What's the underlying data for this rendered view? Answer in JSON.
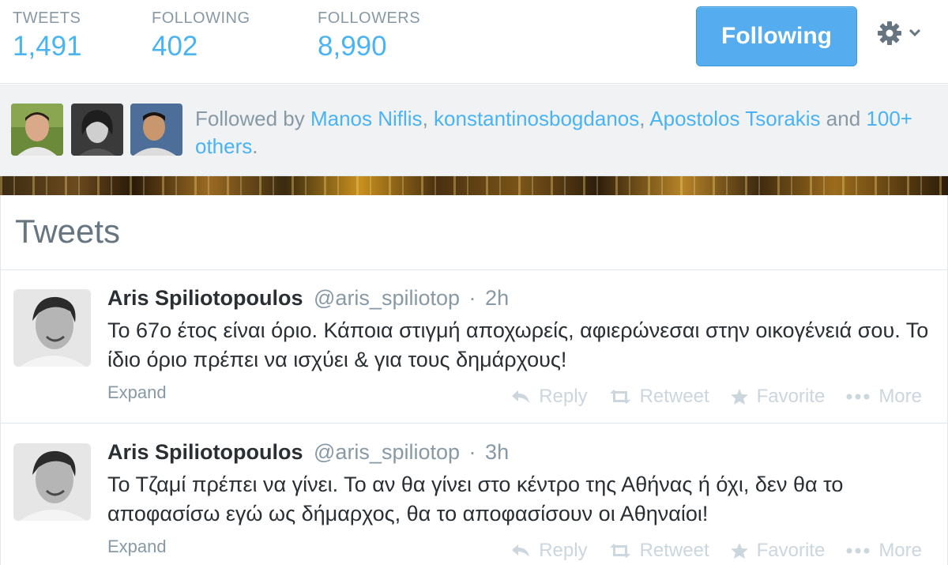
{
  "stats": {
    "tweets_label": "TWEETS",
    "tweets_value": "1,491",
    "following_label": "FOLLOWING",
    "following_value": "402",
    "followers_label": "FOLLOWERS",
    "followers_value": "8,990"
  },
  "follow_button": "Following",
  "followed_by": {
    "prefix": "Followed by",
    "users": [
      "Manos Niflis",
      "konstantinosbogdanos",
      "Apostolos Tsorakis"
    ],
    "sep": ",",
    "and": "and",
    "others": "100+ others",
    "end": "."
  },
  "timeline": {
    "title": "Tweets"
  },
  "tweets": [
    {
      "name": "Aris Spiliotopoulos",
      "handle": "@aris_spiliotop",
      "dot": "·",
      "time": "2h",
      "text": "Το 67ο έτος είναι όριο. Κάποια στιγμή αποχωρείς, αφιερώνεσαι στην οικογένειά σου. Το ίδιο όριο πρέπει να ισχύει & για τους δημάρχους!",
      "expand": "Expand"
    },
    {
      "name": "Aris Spiliotopoulos",
      "handle": "@aris_spiliotop",
      "dot": "·",
      "time": "3h",
      "text": "Το Τζαμί πρέπει να γίνει. Το αν θα γίνει στο κέντρο της Αθήνας ή όχι, δεν θα το αποφασίσω εγώ ως δήμαρχος, θα το αποφασίσουν οι Αθηναίοι!",
      "expand": "Expand"
    }
  ],
  "actions": {
    "reply": "Reply",
    "retweet": "Retweet",
    "favorite": "Favorite",
    "more": "More"
  },
  "colors": {
    "link": "#4ab3f4",
    "button": "#55acee",
    "muted": "#8899a6",
    "action": "#ccd6dd"
  }
}
